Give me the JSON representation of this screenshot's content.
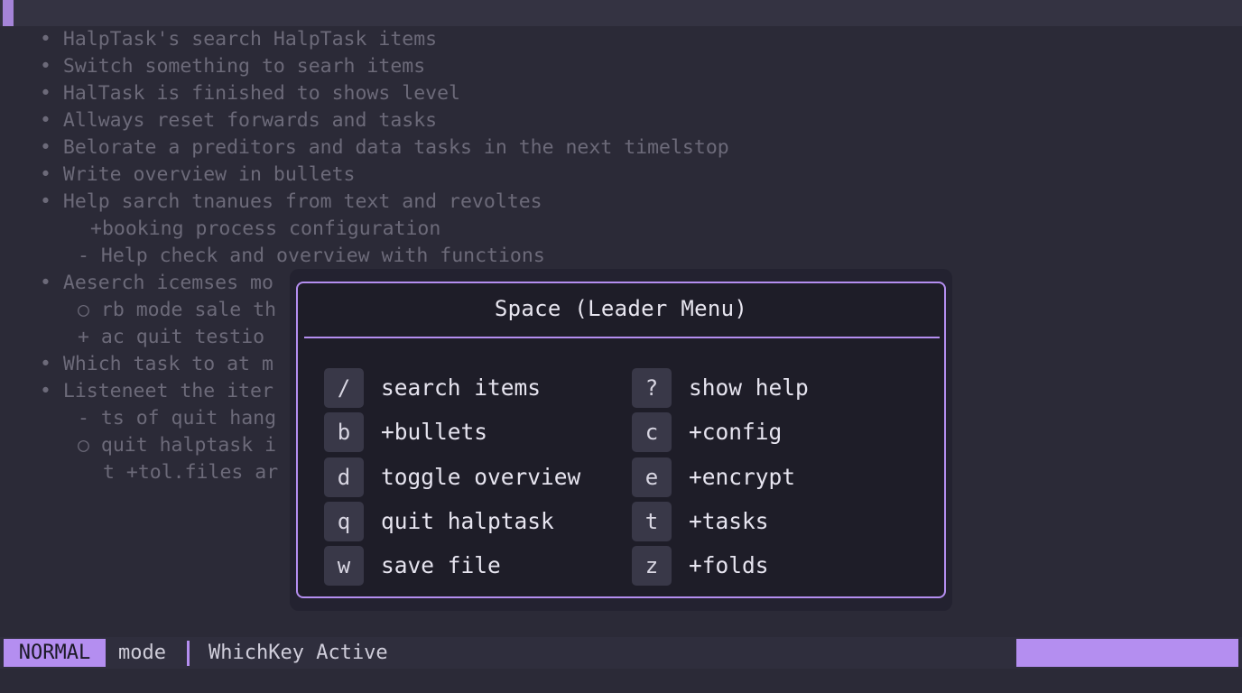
{
  "editor": {
    "lines": [
      "• HalpTask's search HalpTask items",
      "• Switch something to searh items",
      "• HalTask is finished to shows level",
      "• Allways reset forwards and tasks",
      "• Belorate a preditors and data tasks in the next timelstop",
      "• Write overview in bullets",
      "• Help sarch tnanues from text and revoltes",
      "+booking process configuration",
      "- Help check and overview with functions",
      "• Aeserch icemses mo",
      "○ rb mode sale th",
      "+ ac quit testio",
      "• Which task to at m",
      "• Listeneet the iter",
      "- ts of quit hang",
      "○ quit halptask i",
      "t +tol.files ar"
    ]
  },
  "menu": {
    "title": "Space (Leader Menu)",
    "left": [
      {
        "key": "/",
        "label": "search items"
      },
      {
        "key": "b",
        "label": "+bullets"
      },
      {
        "key": "d",
        "label": "toggle overview"
      },
      {
        "key": "q",
        "label": "quit halptask"
      },
      {
        "key": "w",
        "label": "save file"
      }
    ],
    "right": [
      {
        "key": "?",
        "label": "show help"
      },
      {
        "key": "c",
        "label": "+config"
      },
      {
        "key": "e",
        "label": "+encrypt"
      },
      {
        "key": "t",
        "label": "+tasks"
      },
      {
        "key": "z",
        "label": "+folds"
      }
    ]
  },
  "statusline": {
    "mode": "NORMAL",
    "mode_label": "mode",
    "text": "WhichKey Active"
  },
  "colors": {
    "accent": "#b48ef0",
    "background": "#2b2a37",
    "popup_background": "#1e1d28"
  }
}
